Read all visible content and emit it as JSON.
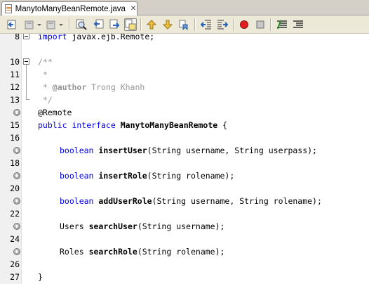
{
  "tab": {
    "label": "ManytoManyBeanRemote.java",
    "close": "✕"
  },
  "toolbar": {
    "buttons": [
      "back-to-source-icon",
      "last-edit-icon",
      "forward-icon",
      "find-icon",
      "find-previous-icon",
      "find-next-icon",
      "toggle-highlight-icon",
      "previous-bookmark-icon",
      "next-bookmark-icon",
      "toggle-bookmark-icon",
      "shift-left-icon",
      "shift-right-icon",
      "record-macro-icon",
      "stop-macro-icon",
      "comment-icon",
      "uncomment-icon"
    ]
  },
  "editor": {
    "line_numbers": [
      "8",
      "10",
      "11",
      "12",
      "13",
      "",
      "15",
      "16",
      "",
      "18",
      "",
      "20",
      "",
      "22",
      "",
      "24",
      "",
      "26",
      "27"
    ],
    "lines": {
      "l8_kw": "import",
      "l8_rest": " javax.ejb.Remote;",
      "l10": "/**",
      "l11": " *",
      "l12_pre": " * ",
      "l12_tag": "@author",
      "l12_rest": " Trong Khanh",
      "l13": " */",
      "l14": "@Remote",
      "l15_kw": "public interface",
      "l15_sp": " ",
      "l15_name": "ManytoManyBeanRemote",
      "l15_rest": " {",
      "l17_kw": "boolean",
      "l17_sp": " ",
      "l17_name": "insertUser",
      "l17_rest": "(String username, String userpass);",
      "l19_kw": "boolean",
      "l19_sp": " ",
      "l19_name": "insertRole",
      "l19_rest": "(String rolename);",
      "l21_kw": "boolean",
      "l21_sp": " ",
      "l21_name": "addUserRole",
      "l21_rest": "(String username, String rolename);",
      "l23_type": "Users",
      "l23_sp": " ",
      "l23_name": "searchUser",
      "l23_rest": "(String username);",
      "l25_type": "Roles",
      "l25_sp": " ",
      "l25_name": "searchRole",
      "l25_rest": "(String rolename);",
      "l27": "}"
    }
  },
  "colors": {
    "keyword": "#0000e6",
    "comment": "#969696",
    "gutter": "#f0f0f0",
    "toolbar": "#ece9d8"
  }
}
